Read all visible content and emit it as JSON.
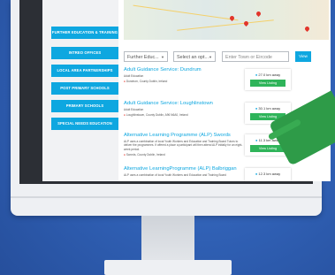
{
  "sidebar": {
    "items": [
      {
        "label": "FURTHER EDUCATION & TRAINING"
      },
      {
        "label": "INTREO OFFICES"
      },
      {
        "label": "LOCAL AREA PARTNERSHIPS"
      },
      {
        "label": "POST PRIMARY SCHOOLS"
      },
      {
        "label": "PRIMARY SCHOOLS"
      },
      {
        "label": "SPECIAL NEEDS EDUCATION"
      }
    ]
  },
  "filters": {
    "category": "Further Educ...",
    "option": "Select an opt...",
    "location_placeholder": "Enter Town or Eircode",
    "go_label": "View"
  },
  "listings": [
    {
      "title": "Adult Guidance Service: Dundrum",
      "desc": "Adult Education",
      "location": "Dundrum, County Dublin, Ireland",
      "distance": "27.0 km away",
      "button": "View Listing"
    },
    {
      "title": "Adult Guidance Service: Loughlinstown",
      "desc": "Adult Education",
      "location": "Loughlinstown, County Dublin, A96 N6A0, Ireland",
      "distance": "30.1 km away",
      "button": "View Listing"
    },
    {
      "title": "Alternative Learning Programme (ALP) Swords",
      "desc": "ALP uses a combination of local Youth Workers and Education and Training Board Tutors to deliver the programmes. If offered a place a participant will then attend ALP initially for an eight-week period.",
      "location": "Swords, County Dublin, Ireland",
      "distance": "11.3 km away",
      "button": "View Listing"
    },
    {
      "title": "Alternative LearningProgramme (ALP) Balbriggan",
      "desc": "ALP uses a combination of local Youth Workers and Education and Training Board",
      "location": "",
      "distance": "12.3 km away",
      "button": ""
    }
  ],
  "colors": {
    "accent": "#0ea7e0",
    "button_green": "#2fb45a",
    "background": "#2f5fb3"
  }
}
